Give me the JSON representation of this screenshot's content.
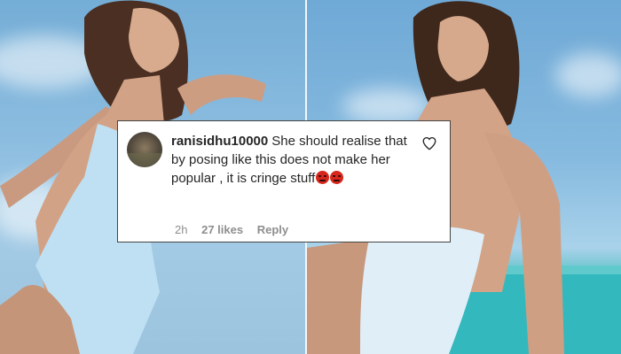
{
  "comment": {
    "username": "ranisidhu10000",
    "text": "She should realise that by posing like this does not make her popular , it is cringe stuff",
    "emoji_count": 2,
    "time": "2h",
    "likes": "27 likes",
    "reply_label": "Reply",
    "like_icon": "heart-outline-icon"
  },
  "colors": {
    "sky": "#7fb4d8",
    "sea": "#2fb2b7",
    "swimsuit": "#bfe0f2",
    "emoji": "#d7261b",
    "text": "#262626",
    "meta": "#8e8e8e"
  }
}
